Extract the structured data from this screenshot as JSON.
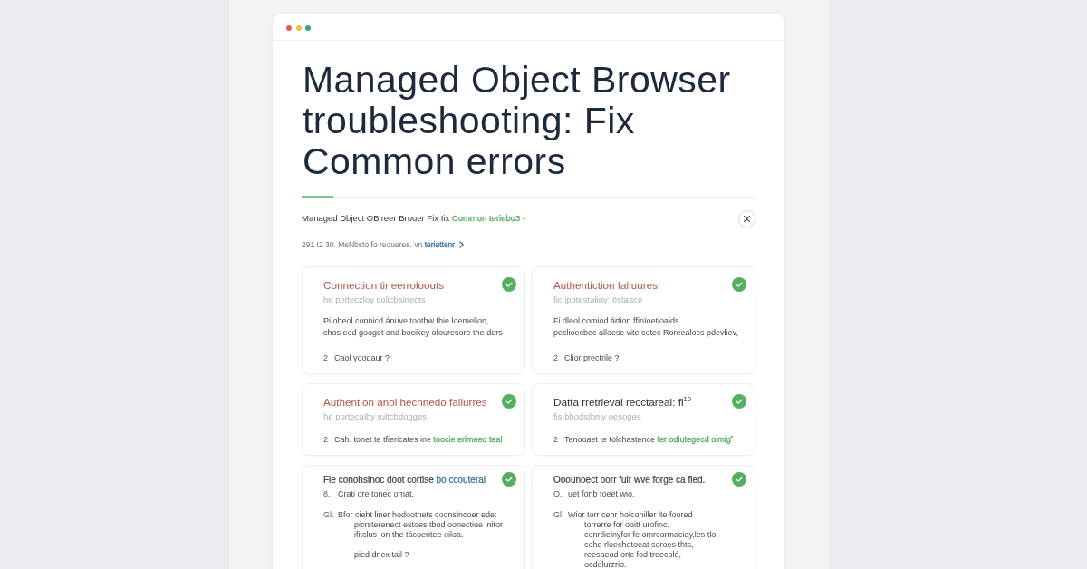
{
  "window": {
    "controls": [
      {
        "color": "#de5a5f"
      },
      {
        "color": "#e8c44c"
      },
      {
        "color": "#2fa87d"
      }
    ]
  },
  "article": {
    "title": "Managed Object Browser troubleshooting: Fix Common errors",
    "summary": [
      {
        "kind": "text",
        "text": "Managed Dbject OBlreer Brouer Fix Iix"
      },
      {
        "kind": "link",
        "text": "Common teriebo3 -",
        "color": "#5cab6b"
      }
    ],
    "breadcrumb": [
      {
        "kind": "text",
        "text": "291 I2 30. MeNbsto fo reoueres. vn"
      },
      {
        "kind": "link",
        "text": "teriettenr",
        "color": "#3f74a6"
      }
    ]
  },
  "cards": [
    {
      "kind": "summary",
      "color": "#b0554d",
      "checked": true,
      "title": [
        {
          "kind": "text",
          "text": "Connection tineerroloouts"
        }
      ],
      "subtitle": "he petteczloy colicbsinects",
      "body": "Pi obeol connicd ánuve toothw tbie loemelion,\nchos eod googet and bocikey ofouresore the ders",
      "items": [
        {
          "marker": "2",
          "parts": [
            {
              "kind": "text",
              "text": "Caol yoodaur ?"
            }
          ]
        }
      ]
    },
    {
      "kind": "summary",
      "color": "#b0554d",
      "checked": true,
      "title": [
        {
          "kind": "text",
          "text": "Authentiction falluures."
        }
      ],
      "subtitle": "fic jpotestaliny: ëstaace",
      "body": "Fi dleol comiod ártion ffinïoetioaids.\npeclioecbec alloesc vite cotec Roreealocs pdevliev,",
      "items": [
        {
          "marker": "2",
          "parts": [
            {
              "kind": "text",
              "text": "Clior prectrile ?"
            }
          ]
        }
      ]
    },
    {
      "kind": "summary",
      "color": "#b0554d",
      "checked": true,
      "title": [
        {
          "kind": "text",
          "text": "Authention anol hecnnedo failurres"
        }
      ],
      "subtitle": "he portecaiby rultcbdogges",
      "items": [
        {
          "marker": "2",
          "parts": [
            {
              "kind": "text",
              "text": "Cah. tonet te tfiericates ine"
            },
            {
              "kind": "link",
              "text": "toocie erimeed teal",
              "color": "#5cab6b"
            }
          ]
        }
      ]
    },
    {
      "kind": "summary",
      "color": "#27303c",
      "checked": true,
      "title": [
        {
          "kind": "text",
          "text": "Datta rretrieval recctareal: fi$^{10}$"
        }
      ],
      "subtitle": "fis bhodstbrily oesoges",
      "items": [
        {
          "marker": "2",
          "parts": [
            {
              "kind": "text",
              "text": "Tenooaet te tolchastence"
            },
            {
              "kind": "link",
              "text": "fer odiutegecd oimig$^{*}$",
              "color": "#5cab6b"
            }
          ]
        }
      ]
    },
    {
      "kind": "steps",
      "color": "#3a3f47",
      "checked": true,
      "title": [
        {
          "kind": "text",
          "text": "Fie conohsinoc doot cortise"
        },
        {
          "kind": "link",
          "text": "bo ccouteral",
          "color": "#3f74a6"
        }
      ],
      "items": [
        {
          "marker": "8.",
          "parts": [
            {
              "kind": "text",
              "text": "Crati ore tonec omat."
            }
          ]
        },
        {
          "marker": "Gl.",
          "parts": [
            {
              "kind": "text",
              "text": "Bfor cieht liner hodootnets coonslncoer ede:\npicrsterenect estoes tbod oonectiue initor\nifitclus jon the tácoeritee oiloa."
            }
          ]
        }
      ],
      "note": "pied dnex tail ?"
    },
    {
      "kind": "steps",
      "color": "#3a3f47",
      "checked": true,
      "title": [
        {
          "kind": "text",
          "text": "Ooounoect oorr fuir wve forge ca fied."
        }
      ],
      "items": [
        {
          "marker": "O.",
          "parts": [
            {
              "kind": "text",
              "text": "uet fonb toeet wio."
            }
          ]
        },
        {
          "marker": "Gl",
          "parts": [
            {
              "kind": "text",
              "text": "Wior torr cenr holconiller lte foored\ntorrerre for ooitt urofinc.\nconrtlieinyfor fe omrcormaciay,les tlo.\ncohe rloechetoeat soroes thts,\nreesaeod ortc fod treecolé,\nocdolurzrio."
            }
          ]
        }
      ]
    }
  ]
}
